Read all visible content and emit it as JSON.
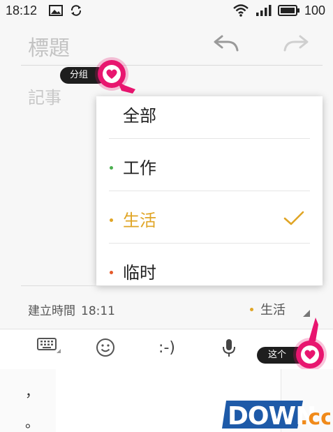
{
  "status_bar": {
    "time": "18:12",
    "battery": "100"
  },
  "editor": {
    "title_placeholder": "標題",
    "note_placeholder": "記事",
    "created_label": "建立時間",
    "created_time": "18:11",
    "current_category": "生活"
  },
  "tooltips": {
    "group": "分组",
    "this": "这个"
  },
  "category_menu": {
    "items": [
      {
        "label": "全部",
        "bullet_color": "",
        "text_color": "#222222",
        "selected": false
      },
      {
        "label": "工作",
        "bullet_color": "#4caf50",
        "text_color": "#222222",
        "selected": false
      },
      {
        "label": "生活",
        "bullet_color": "#e0a526",
        "text_color": "#e0a526",
        "selected": true
      },
      {
        "label": "临时",
        "bullet_color": "#e55a2b",
        "text_color": "#222222",
        "selected": false
      }
    ]
  },
  "ime_toolbar": {
    "emoticon_text": ":-)",
    "candidates_left": [
      "，",
      "。"
    ]
  },
  "watermark": {
    "text_main": "DOWN",
    "text_suffix": ".cc"
  },
  "colors": {
    "accent_pink": "#e8156f",
    "selected_yellow": "#e0a526"
  }
}
